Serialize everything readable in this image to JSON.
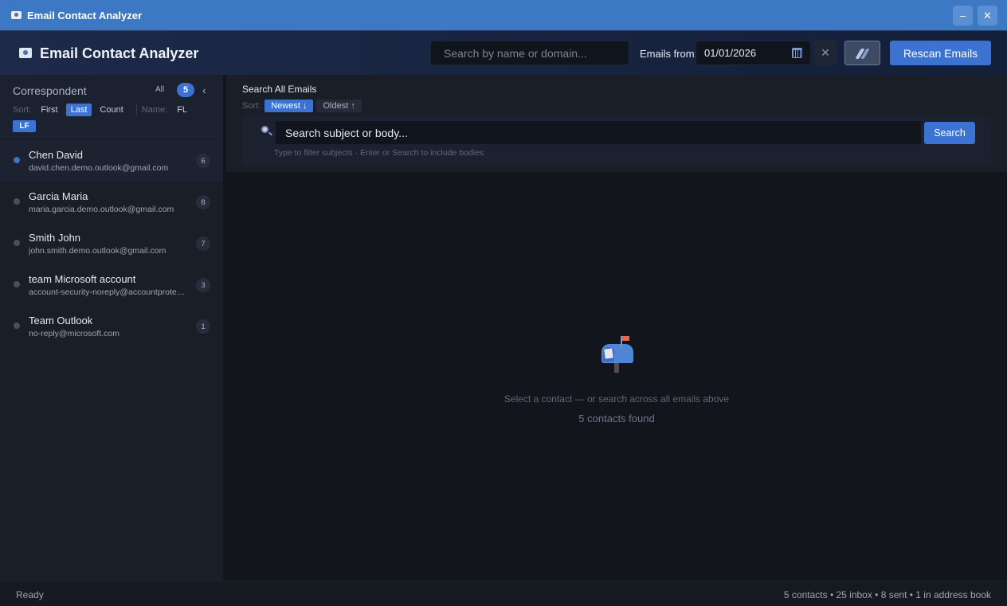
{
  "window": {
    "title": "Email Contact Analyzer",
    "minimize_glyph": "–",
    "close_glyph": "✕"
  },
  "header": {
    "app_title": "Email Contact Analyzer",
    "search_placeholder": "Search by name or domain...",
    "emails_from_label": "Emails from:",
    "date_value": "01/01/2026",
    "clear_glyph": "✕",
    "rescan_label": "Rescan Emails",
    "accent_color": "#3c72d2"
  },
  "sidebar": {
    "title": "Correspondent",
    "all_label": "All",
    "count": "5",
    "collapse_glyph": "‹",
    "sort_label": "Sort:",
    "sort_options": [
      "First",
      "Last",
      "Count"
    ],
    "sort_active": "Last",
    "name_label": "Name:",
    "name_options": [
      "FL",
      "LF"
    ],
    "name_active": "LF",
    "contacts": [
      {
        "name": "Chen David",
        "email": "david.chen.demo.outlook@gmail.com",
        "count": "6",
        "selected": true
      },
      {
        "name": "Garcia Maria",
        "email": "maria.garcia.demo.outlook@gmail.com",
        "count": "8",
        "selected": false
      },
      {
        "name": "Smith John",
        "email": "john.smith.demo.outlook@gmail.com",
        "count": "7",
        "selected": false
      },
      {
        "name": "team Microsoft account",
        "email": "account-security-noreply@accountprotection.microsoft.com",
        "count": "3",
        "selected": false
      },
      {
        "name": "Team Outlook",
        "email": "no-reply@microsoft.com",
        "count": "1",
        "selected": false
      }
    ]
  },
  "email_search": {
    "title": "Search All Emails",
    "sort_label": "Sort:",
    "newest_label": "Newest ↓",
    "oldest_label": "Oldest ↑",
    "placeholder": "Search subject or body...",
    "search_button": "Search",
    "hint": "Type to filter subjects · Enter or Search to include bodies"
  },
  "empty_state": {
    "icon": "mailbox-icon",
    "message": "Select a contact — or search across all emails above",
    "count_text": "5 contacts found"
  },
  "status": {
    "left": "Ready",
    "right": "5 contacts • 25 inbox • 8 sent • 1 in address book"
  }
}
